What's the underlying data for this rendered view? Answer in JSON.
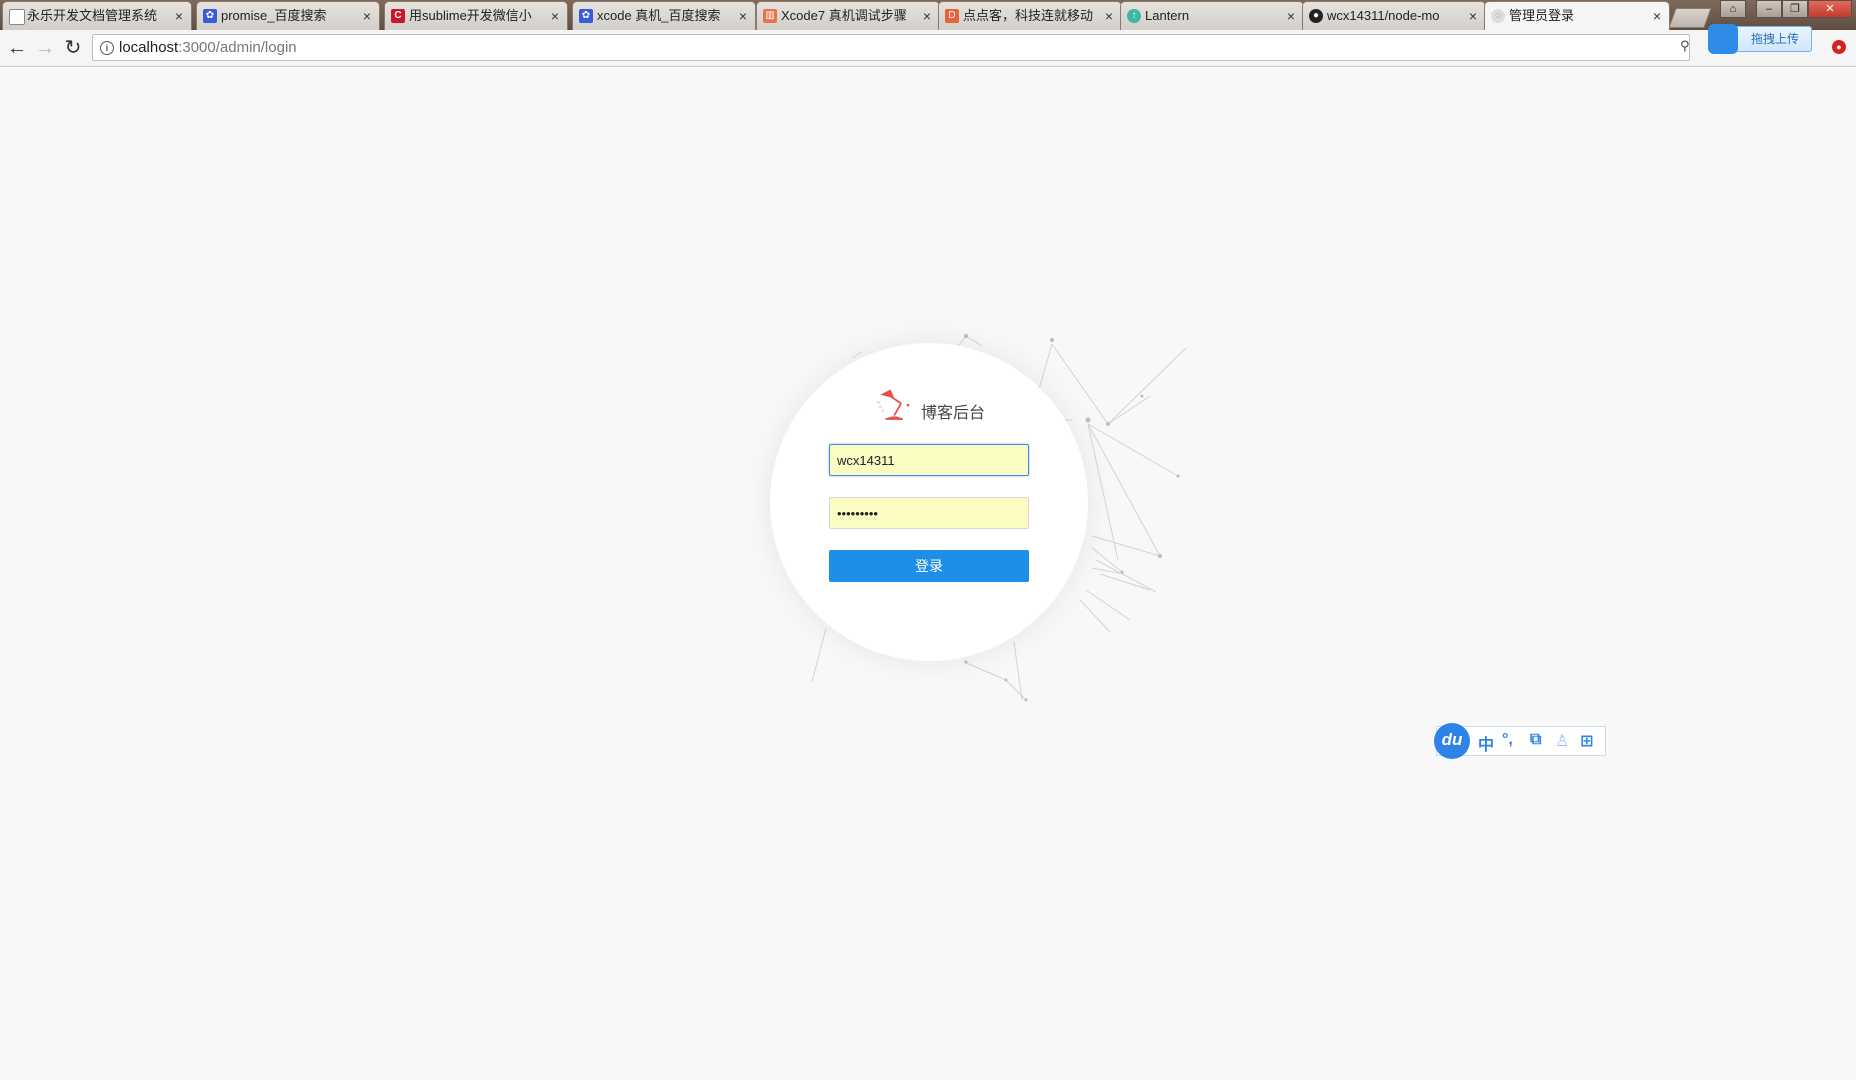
{
  "browser": {
    "tabs": [
      {
        "label": "永乐开发文档管理系统",
        "favicon": "page-icon",
        "color": "#888888"
      },
      {
        "label": "promise_百度搜索",
        "favicon": "baidu-icon",
        "color": "#3a5bd9"
      },
      {
        "label": "用sublime开发微信小",
        "favicon": "csdn-icon",
        "color": "#c8182a"
      },
      {
        "label": "xcode 真机_百度搜索",
        "favicon": "baidu-icon",
        "color": "#3a5bd9"
      },
      {
        "label": "Xcode7 真机调试步骤",
        "favicon": "site-icon",
        "color": "#e8754a"
      },
      {
        "label": "点点客，科技连就移动",
        "favicon": "diandian-icon",
        "color": "#e8613a"
      },
      {
        "label": "Lantern",
        "favicon": "lantern-icon",
        "color": "#3fb7a7"
      },
      {
        "label": "wcx14311/node-mo",
        "favicon": "github-icon",
        "color": "#222222"
      },
      {
        "label": "管理员登录",
        "favicon": "loading-icon",
        "color": "#9a9a9a"
      }
    ],
    "active_tab_index": 8,
    "address": {
      "host": "localhost",
      "path": ":3000/admin/login"
    },
    "upload_label": "拖拽上传"
  },
  "login": {
    "brand_title": "博客后台",
    "username": "wcx14311",
    "password": "•••••••••",
    "submit_label": "登录"
  },
  "ime": {
    "logo": "du",
    "items": [
      "中",
      "°,",
      "⧉",
      "♙",
      "⊞"
    ],
    "accent": "#2f82e8"
  }
}
